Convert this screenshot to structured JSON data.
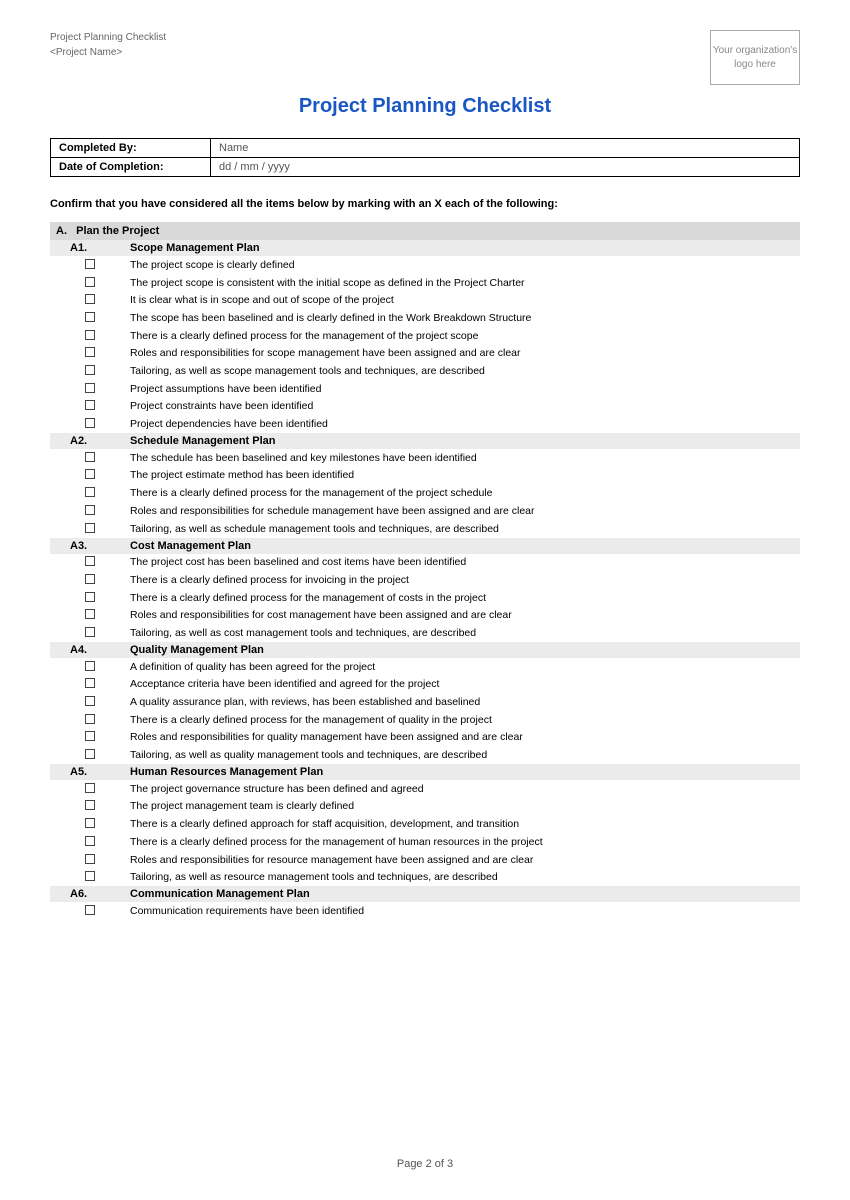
{
  "header": {
    "doc_name": "Project Planning Checklist",
    "project_label": "<Project Name>",
    "logo_text": "Your organization's logo here"
  },
  "title": "Project Planning Checklist",
  "info_fields": [
    {
      "label": "Completed By:",
      "value": "Name"
    },
    {
      "label": "Date of Completion:",
      "value": "dd / mm / yyyy"
    }
  ],
  "instruction": "Confirm that you have considered all the items below by marking with an X each of the following:",
  "section_a": {
    "label": "A.   Plan the Project",
    "subsections": [
      {
        "num": "A1.",
        "title": "Scope Management Plan",
        "items": [
          "The project scope is clearly defined",
          "The project scope is consistent with the initial scope as defined in the Project Charter",
          "It is clear what is in scope and out of scope of the project",
          "The scope has been baselined and is clearly defined in the Work Breakdown Structure",
          "There is a clearly defined process for the management of the project scope",
          "Roles and responsibilities for scope management have been assigned and are clear",
          "Tailoring, as well as scope management tools and techniques, are described",
          "Project assumptions have been identified",
          "Project constraints have been identified",
          "Project dependencies have been identified"
        ]
      },
      {
        "num": "A2.",
        "title": "Schedule Management Plan",
        "items": [
          "The schedule has been baselined and key milestones have been identified",
          "The project estimate method has been identified",
          "There is a clearly defined process for the management of the project schedule",
          "Roles and responsibilities for schedule management have been assigned and are clear",
          "Tailoring, as well as schedule management tools and techniques, are described"
        ]
      },
      {
        "num": "A3.",
        "title": "Cost Management Plan",
        "items": [
          "The project cost has been baselined and cost items have been identified",
          "There is a clearly defined process for invoicing in the project",
          "There is a clearly defined process for the management of costs in the project",
          "Roles and responsibilities for cost management have been assigned and are clear",
          "Tailoring, as well as cost management tools and techniques, are described"
        ]
      },
      {
        "num": "A4.",
        "title": "Quality Management Plan",
        "items": [
          "A definition of quality has been agreed for the project",
          "Acceptance criteria have been identified and agreed for the project",
          "A quality assurance plan, with reviews, has been established and baselined",
          "There is a clearly defined process for the management of quality in the project",
          "Roles and responsibilities for quality management have been assigned and are clear",
          "Tailoring, as well as quality management tools and techniques, are described"
        ]
      },
      {
        "num": "A5.",
        "title": "Human Resources Management Plan",
        "items": [
          "The project governance structure has been defined and agreed",
          "The project management team is clearly defined",
          "There is a clearly defined approach for staff acquisition, development, and transition",
          "There is a clearly defined process for the management of human resources in the project",
          "Roles and responsibilities for resource management have been assigned and are clear",
          "Tailoring, as well as resource management tools and techniques, are described"
        ]
      },
      {
        "num": "A6.",
        "title": "Communication Management Plan",
        "items": [
          "Communication requirements have been identified"
        ]
      }
    ]
  },
  "footer": {
    "page": "Page 2 of 3"
  }
}
